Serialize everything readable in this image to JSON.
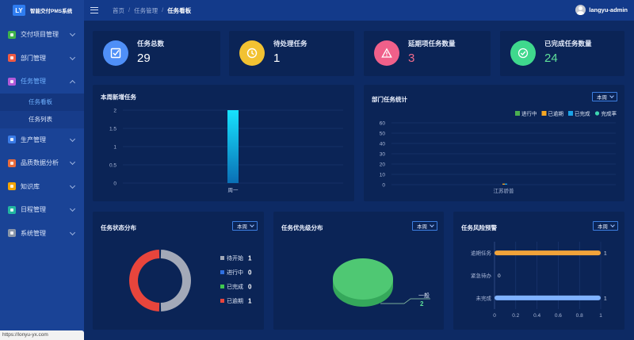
{
  "app": {
    "logo": "LY",
    "title": "智能交付PMS系统"
  },
  "sidebar": {
    "items": [
      {
        "label": "交付项目管理",
        "color": "#3fb24a",
        "icon": "project-icon"
      },
      {
        "label": "部门管理",
        "color": "#ef5a43",
        "icon": "department-icon"
      },
      {
        "label": "任务管理",
        "color": "#b25ad8",
        "icon": "task-icon"
      },
      {
        "label": "生产管理",
        "color": "#3a7be6",
        "icon": "production-icon"
      },
      {
        "label": "品质数据分析",
        "color": "#e86b3b",
        "icon": "quality-icon"
      },
      {
        "label": "知识库",
        "color": "#f2a400",
        "icon": "knowledge-icon"
      },
      {
        "label": "日程管理",
        "color": "#22b5a0",
        "icon": "calendar-icon"
      },
      {
        "label": "系统管理",
        "color": "#8a96a8",
        "icon": "settings-icon"
      }
    ],
    "sub_items": [
      {
        "label": "任务看板"
      },
      {
        "label": "任务列表"
      }
    ]
  },
  "status_url": "https://lonyu-yx.com",
  "breadcrumb": {
    "home": "首页",
    "parent": "任务管理",
    "current": "任务看板"
  },
  "user": {
    "name": "langyu-admin"
  },
  "stats": [
    {
      "label": "任务总数",
      "value": "29",
      "color": "#4f8ff7",
      "value_color": "#ffffff",
      "icon": "check-square-icon"
    },
    {
      "label": "待处理任务",
      "value": "1",
      "color": "#f2c232",
      "value_color": "#ffffff",
      "icon": "clock-icon"
    },
    {
      "label": "延期项任务数量",
      "value": "3",
      "color": "#f0608a",
      "value_color": "#f06b8c",
      "icon": "warning-icon"
    },
    {
      "label": "已完成任务数量",
      "value": "24",
      "color": "#3fd88d",
      "value_color": "#5fe09a",
      "icon": "check-circle-icon"
    }
  ],
  "panels": {
    "weekly": {
      "title": "本周新增任务"
    },
    "dept": {
      "title": "部门任务统计",
      "select": "本周"
    },
    "status": {
      "title": "任务状态分布",
      "select": "本周"
    },
    "priority": {
      "title": "任务优先级分布",
      "select": "本周"
    },
    "risk": {
      "title": "任务风险预警",
      "select": "本周"
    }
  },
  "chart_data": [
    {
      "type": "bar",
      "categories": [
        "周一"
      ],
      "values": [
        2
      ],
      "ylim": [
        0,
        2
      ],
      "yticks": [
        "0",
        "0.5",
        "1",
        "1.5",
        "2"
      ],
      "color": "#14d2f5"
    },
    {
      "type": "bar",
      "categories": [
        "江苏骄普"
      ],
      "series": [
        {
          "name": "进行中",
          "values": [
            0
          ],
          "color": "#4caf50"
        },
        {
          "name": "已逾期",
          "values": [
            1
          ],
          "color": "#f5a623"
        },
        {
          "name": "已完成",
          "values": [
            1
          ],
          "color": "#1aa3e8"
        },
        {
          "name": "完成率",
          "values": [
            0
          ],
          "color": "#3ed6b0"
        }
      ],
      "ylim": [
        0,
        60
      ],
      "yticks": [
        "0",
        "10",
        "20",
        "30",
        "40",
        "50",
        "60"
      ]
    },
    {
      "type": "pie",
      "categories": [
        "待开始",
        "进行中",
        "已完成",
        "已逾期"
      ],
      "values": [
        1,
        0,
        0,
        1
      ],
      "colors": [
        "#a3a9b8",
        "#2f6fe0",
        "#3fc84f",
        "#e8453c"
      ]
    },
    {
      "type": "pie",
      "categories": [
        "一般"
      ],
      "values": [
        2
      ],
      "colors": [
        "#4fc873"
      ]
    },
    {
      "type": "bar",
      "orientation": "horizontal",
      "categories": [
        "逾期任务",
        "紧急待办",
        "未完成"
      ],
      "values": [
        1,
        0,
        1
      ],
      "colors": [
        "#f2a43a",
        "#f2a43a",
        "#7fb2ff"
      ],
      "xlim": [
        0,
        1
      ],
      "xticks": [
        "0",
        "0.2",
        "0.4",
        "0.6",
        "0.8",
        "1"
      ]
    }
  ]
}
